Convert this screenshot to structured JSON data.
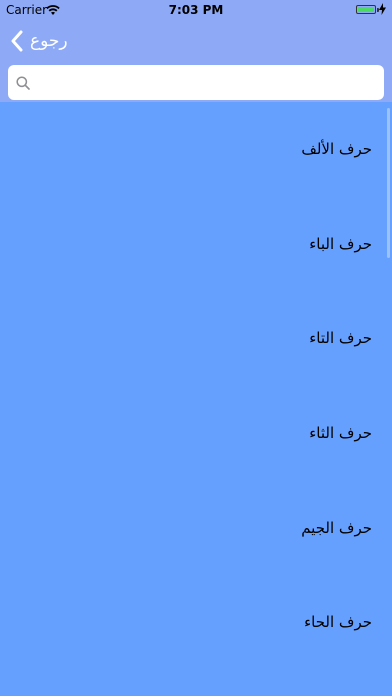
{
  "status_bar": {
    "carrier": "Carrier",
    "time": "7:03 PM",
    "battery_level": 1.0
  },
  "nav": {
    "back_label": "رجوع"
  },
  "search": {
    "placeholder": ""
  },
  "list": {
    "items": [
      {
        "label": "حرف الألف"
      },
      {
        "label": "حرف الباء"
      },
      {
        "label": "حرف التاء"
      },
      {
        "label": "حرف الثاء"
      },
      {
        "label": "حرف الجيم"
      },
      {
        "label": "حرف الحاء"
      }
    ]
  },
  "colors": {
    "nav_background": "#8eaaf6",
    "list_background": "#66a0ff",
    "battery_fill": "#4cd964"
  }
}
